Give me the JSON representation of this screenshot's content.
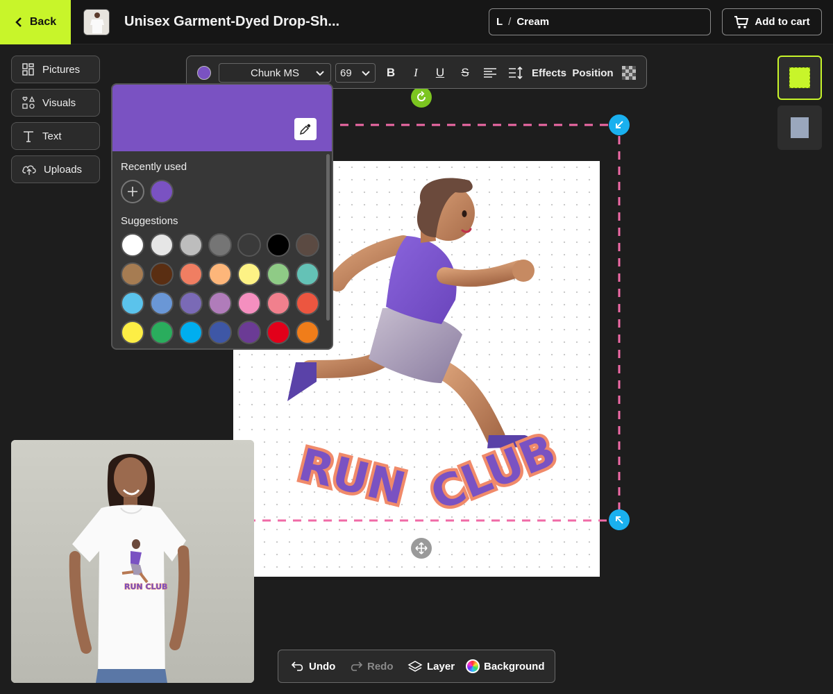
{
  "header": {
    "back_label": "Back",
    "product_title": "Unisex Garment-Dyed Drop-Sh...",
    "variant_size": "L",
    "variant_separator": "/",
    "variant_color": "Cream",
    "cart_label": "Add to cart"
  },
  "left_toolbar": {
    "pictures": "Pictures",
    "visuals": "Visuals",
    "text": "Text",
    "uploads": "Uploads"
  },
  "text_toolbar": {
    "color": "#7a52c2",
    "font": "Chunk MS",
    "size": "69",
    "bold": "B",
    "italic": "I",
    "underline": "U",
    "strike": "S",
    "effects": "Effects",
    "position": "Position"
  },
  "color_picker": {
    "selected": "#7a52c2",
    "recent_title": "Recently used",
    "recent": [
      "#7a52c2"
    ],
    "suggestions_title": "Suggestions",
    "suggestions": [
      "#ffffff",
      "#e6e6e6",
      "#bdbdbd",
      "#757575",
      "#3a3a3a",
      "#000000",
      "#5b4a42",
      "#a67c52",
      "#5a2e12",
      "#f07e62",
      "#fdb67a",
      "#fdf285",
      "#8fcb86",
      "#64c2b6",
      "#5bc3ec",
      "#6a97d6",
      "#7a6ab6",
      "#b07cba",
      "#f48fbf",
      "#f1808d",
      "#ec5640",
      "#fdee45",
      "#2aad5d",
      "#00aeef",
      "#3e57a6",
      "#6b3b95",
      "#e2001a",
      "#f07d1a"
    ]
  },
  "design": {
    "text_line_1": "RUN",
    "text_line_2": "CLUB",
    "text_fill": "#7a52c2",
    "text_outline": "#f08a6a"
  },
  "mockup": {
    "text": "RUN CLUB"
  },
  "bottom_bar": {
    "undo": "Undo",
    "redo": "Redo",
    "layer": "Layer",
    "background": "Background"
  },
  "accent": "#c8f52a",
  "handle_color": "#1ab0ef",
  "selection_color": "#f06aa6"
}
